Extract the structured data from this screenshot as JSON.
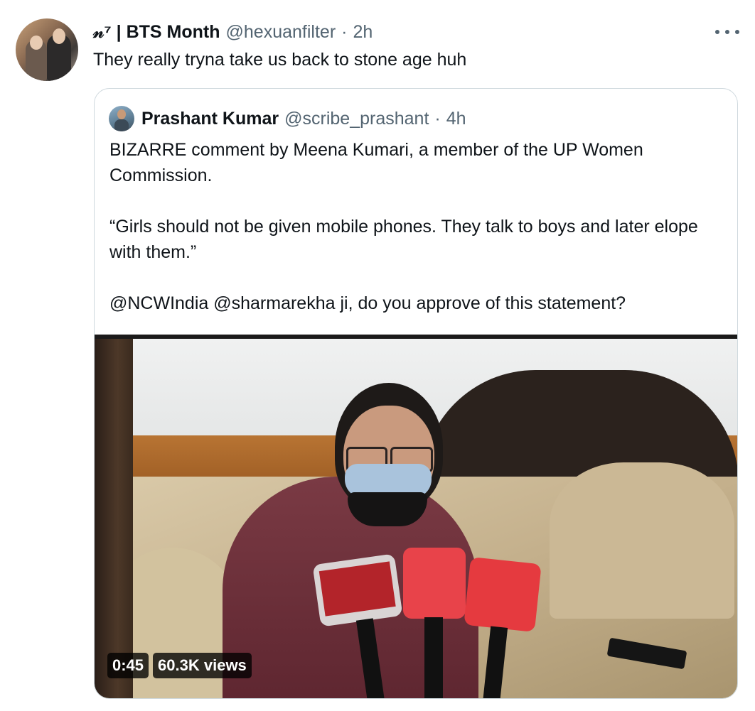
{
  "tweet": {
    "author_name": "𝓃⁷ | BTS Month",
    "author_handle": "@hexuanfilter",
    "separator": "·",
    "time": "2h",
    "text": "They really tryna take us back to stone age huh",
    "more_icon": "more-horizontal-icon"
  },
  "quote": {
    "author_name": "Prashant Kumar",
    "author_handle": "@scribe_prashant",
    "separator": "·",
    "time": "4h",
    "paragraphs": [
      "BIZARRE comment by Meena Kumari, a member of the UP Women Commission.",
      "“Girls should not be given mobile phones. They talk to boys and later elope with them.”",
      "@NCWIndia @sharmarekha ji, do you approve of this statement?"
    ],
    "video": {
      "duration": "0:45",
      "views": "60.3K views"
    }
  }
}
